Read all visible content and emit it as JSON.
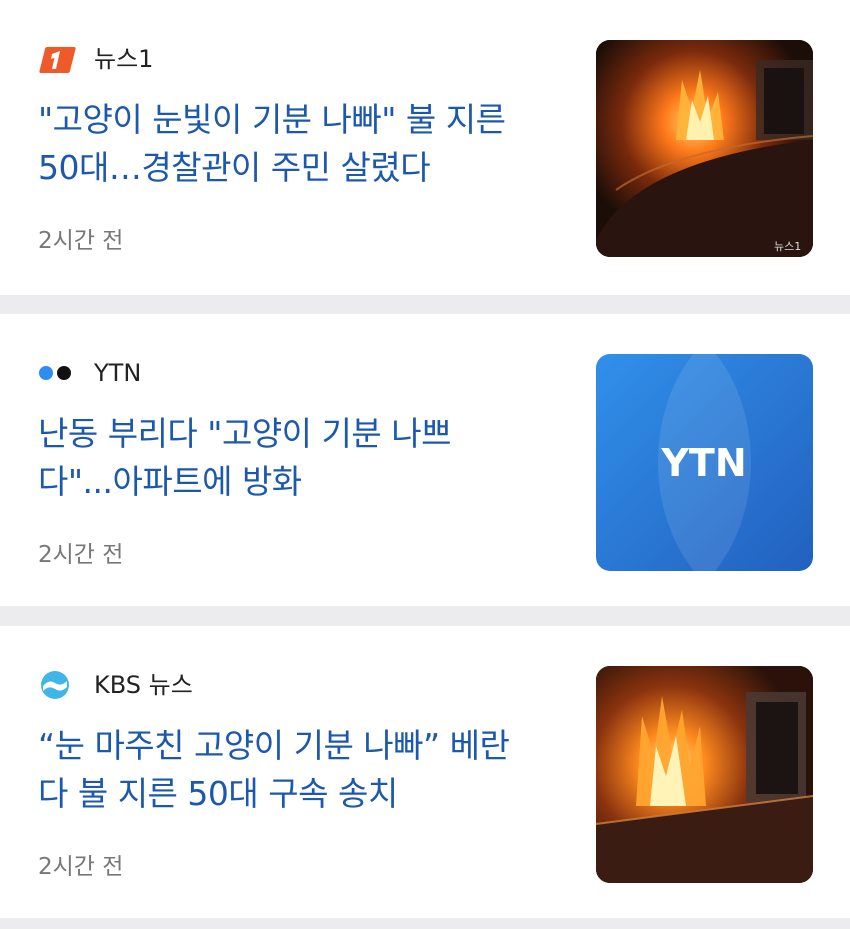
{
  "articles": [
    {
      "source": "뉴스1",
      "source_icon": "news1-logo-icon",
      "headline": "\"고양이 눈빛이 기분 나빠\" 불 지른 50대…경찰관이 주민 살렸다",
      "headline_lines": [
        "\"고양이 눈빛이 기분 나빠\" 불 지른",
        "50대…경찰관이 주민 살렸다"
      ],
      "time": "2시간 전",
      "thumbnail": "fire-photo-thumbnail",
      "thumb_watermark": "뉴스1"
    },
    {
      "source": "YTN",
      "source_icon": "ytn-dots-icon",
      "headline": "난동 부리다 \"고양이 기분 나쁘다\"...아파트에 방화",
      "headline_lines": [
        "난동 부리다 \"고양이 기분 나쁘",
        "다\"...아파트에 방화"
      ],
      "time": "2시간 전",
      "thumbnail": "ytn-logo-thumbnail",
      "thumb_text": "YTN"
    },
    {
      "source": "KBS 뉴스",
      "source_icon": "kbs-logo-icon",
      "headline": "“눈 마주친 고양이 기분 나빠” 베란다 불 지른 50대 구속 송치",
      "headline_lines": [
        "“눈 마주친 고양이 기분 나빠” 베란",
        "다 불 지른 50대 구속 송치"
      ],
      "time": "2시간 전",
      "thumbnail": "fire-photo-thumbnail"
    }
  ],
  "colors": {
    "headline": "#1c58ad",
    "separator": "#ececef",
    "news1_orange": "#f0592a",
    "ytn_blue": "#1a6fd6",
    "kbs_cyan": "#3fb6e8"
  }
}
